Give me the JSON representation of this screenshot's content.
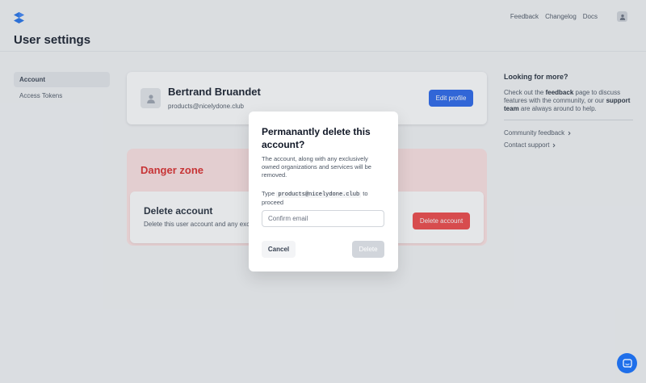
{
  "header": {
    "title": "User settings",
    "nav": [
      {
        "label": "Feedback"
      },
      {
        "label": "Changelog"
      },
      {
        "label": "Docs"
      }
    ]
  },
  "sidebar": {
    "items": [
      {
        "label": "Account",
        "active": true
      },
      {
        "label": "Access Tokens",
        "active": false
      }
    ]
  },
  "profile": {
    "name": "Bertrand Bruandet",
    "email": "products@nicelydone.club",
    "edit_label": "Edit profile"
  },
  "danger_zone": {
    "title": "Danger zone",
    "card_title": "Delete account",
    "card_desc": "Delete this user account and any exc",
    "button_label": "Delete account"
  },
  "aside": {
    "title": "Looking for more?",
    "text_parts": [
      "Check out the ",
      "feedback",
      " page to discuss features with the community, or our ",
      "support team",
      " are always around to help."
    ],
    "links": [
      {
        "label": "Community feedback"
      },
      {
        "label": "Contact support"
      }
    ]
  },
  "modal": {
    "title": "Permanantly delete this account?",
    "description": "The account, along with any exclusively owned organizations and services will be removed.",
    "prompt_before": "Type ",
    "prompt_email": "products@nicelydone.club",
    "prompt_after": " to proceed",
    "input_placeholder": "Confirm email",
    "input_value": "",
    "cancel_label": "Cancel",
    "confirm_label": "Delete"
  },
  "colors": {
    "primary": "#2563eb",
    "danger": "#ef4444",
    "danger_bg": "#fee2e2",
    "chat": "#1f6fea"
  },
  "icons": {
    "logo": "brand-logo-icon",
    "avatar": "user-icon",
    "chevron": "chevron-right-icon",
    "chat": "chat-icon"
  }
}
